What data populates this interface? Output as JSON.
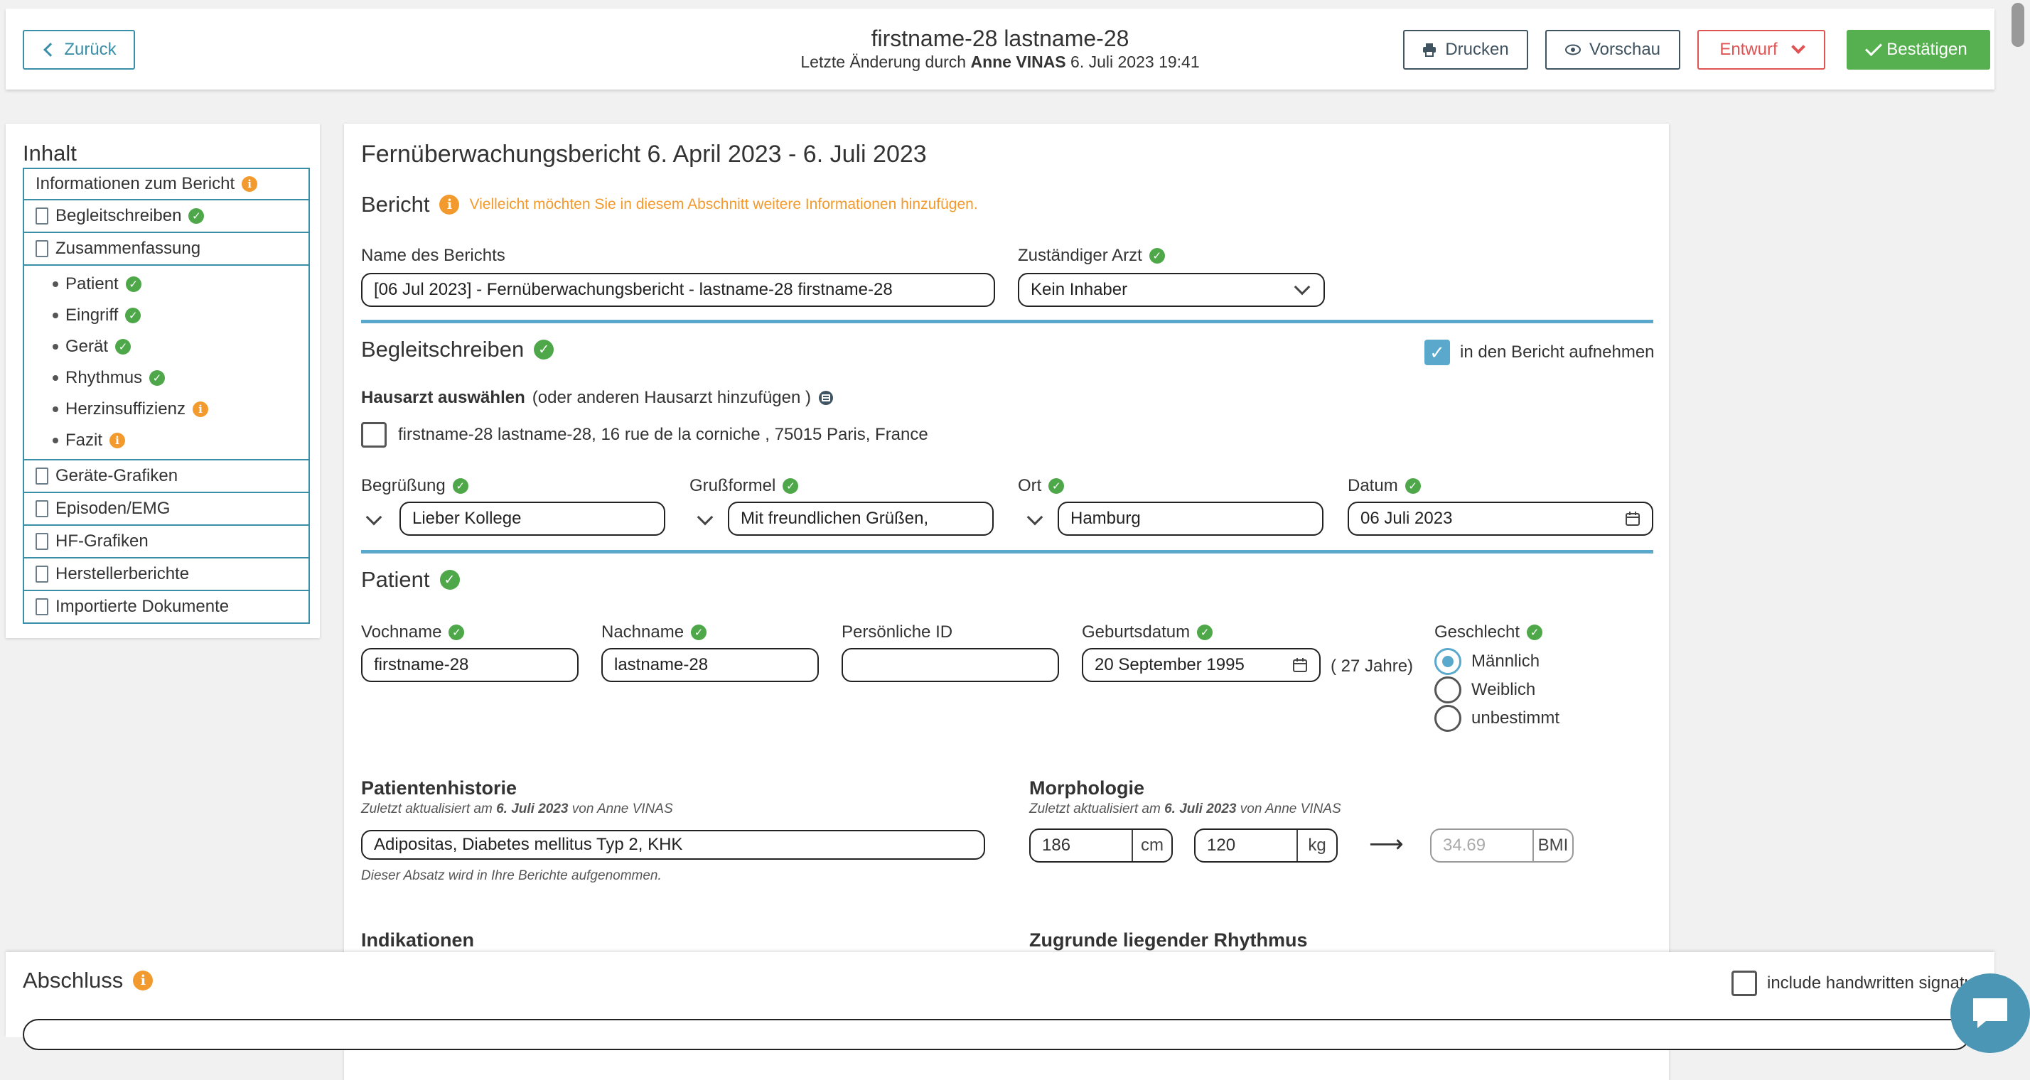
{
  "header": {
    "back_label": "Zurück",
    "title": "firstname-28 lastname-28",
    "subtitle_prefix": "Letzte Änderung durch",
    "subtitle_author": "Anne VINAS",
    "subtitle_date": "6. Juli 2023 19:41",
    "print_label": "Drucken",
    "preview_label": "Vorschau",
    "draft_label": "Entwurf",
    "confirm_label": "Bestätigen"
  },
  "sidebar": {
    "title": "Inhalt",
    "items": [
      {
        "label": "Informationen zum Bericht",
        "status": "info"
      },
      {
        "label": "Begleitschreiben",
        "status": "ok"
      },
      {
        "label": "Zusammenfassung",
        "status": ""
      },
      {
        "label": "Patient",
        "status": "ok"
      },
      {
        "label": "Eingriff",
        "status": "ok"
      },
      {
        "label": "Gerät",
        "status": "ok"
      },
      {
        "label": "Rhythmus",
        "status": "ok"
      },
      {
        "label": "Herzinsuffizienz",
        "status": "info"
      },
      {
        "label": "Fazit",
        "status": "info"
      },
      {
        "label": "Geräte-Grafiken",
        "status": ""
      },
      {
        "label": "Episoden/EMG",
        "status": ""
      },
      {
        "label": "HF-Grafiken",
        "status": ""
      },
      {
        "label": "Herstellerberichte",
        "status": ""
      },
      {
        "label": "Importierte Dokumente",
        "status": ""
      }
    ]
  },
  "main": {
    "report_title": "Fernüberwachungsbericht 6. April 2023 - 6. Juli 2023",
    "bericht": {
      "heading": "Bericht",
      "hint": "Vielleicht möchten Sie in diesem Abschnitt weitere Informationen hinzufügen.",
      "name_label": "Name des Berichts",
      "name_value": "[06 Jul 2023] - Fernüberwachungsbericht - lastname-28 firstname-28",
      "doctor_label": "Zuständiger Arzt",
      "doctor_value": "Kein Inhaber"
    },
    "begleitschreiben": {
      "heading": "Begleitschreiben",
      "include_label": "in den Bericht aufnehmen",
      "gp_label": "Hausarzt auswählen",
      "gp_hint": "(oder anderen Hausarzt hinzufügen )",
      "gp_option": "firstname-28 lastname-28, 16 rue de la corniche , 75015 Paris, France",
      "greeting_label": "Begrüßung",
      "greeting_value": "Lieber Kollege",
      "closing_label": "Grußformel",
      "closing_value": "Mit freundlichen Grüßen,",
      "place_label": "Ort",
      "place_value": "Hamburg",
      "date_label": "Datum",
      "date_value": "06 Juli 2023"
    },
    "patient": {
      "heading": "Patient",
      "firstname_label": "Vochname",
      "firstname_value": "firstname-28",
      "lastname_label": "Nachname",
      "lastname_value": "lastname-28",
      "id_label": "Persönliche ID",
      "id_value": "",
      "birth_label": "Geburtsdatum",
      "birth_value": "20 September 1995",
      "age": "( 27 Jahre)",
      "gender_label": "Geschlecht",
      "gender_options": [
        "Männlich",
        "Weiblich",
        "unbestimmt"
      ],
      "gender_selected": "Männlich"
    },
    "history": {
      "heading": "Patientenhistorie",
      "updated_prefix": "Zuletzt aktualisiert am",
      "updated_date": "6. Juli 2023",
      "updated_by": "von Anne VINAS",
      "value": "Adipositas, Diabetes mellitus Typ 2, KHK",
      "note": "Dieser Absatz wird in Ihre Berichte aufgenommen."
    },
    "morphology": {
      "heading": "Morphologie",
      "updated_prefix": "Zuletzt aktualisiert am",
      "updated_date": "6. Juli 2023",
      "updated_by": "von Anne VINAS",
      "height_value": "186",
      "height_unit": "cm",
      "weight_value": "120",
      "weight_unit": "kg",
      "arrow": "⟶",
      "bmi_value": "34.69",
      "bmi_unit": "BMI"
    },
    "indications_heading": "Indikationen",
    "rhythm_heading": "Zugrunde liegender Rhythmus"
  },
  "bottom": {
    "heading": "Abschluss",
    "signature_label": "include handwritten signature"
  },
  "colors": {
    "accent": "#3a8fa8",
    "ok": "#4ea84a",
    "warning": "#f29a2e",
    "danger": "#e05353",
    "confirm": "#56b04f"
  }
}
